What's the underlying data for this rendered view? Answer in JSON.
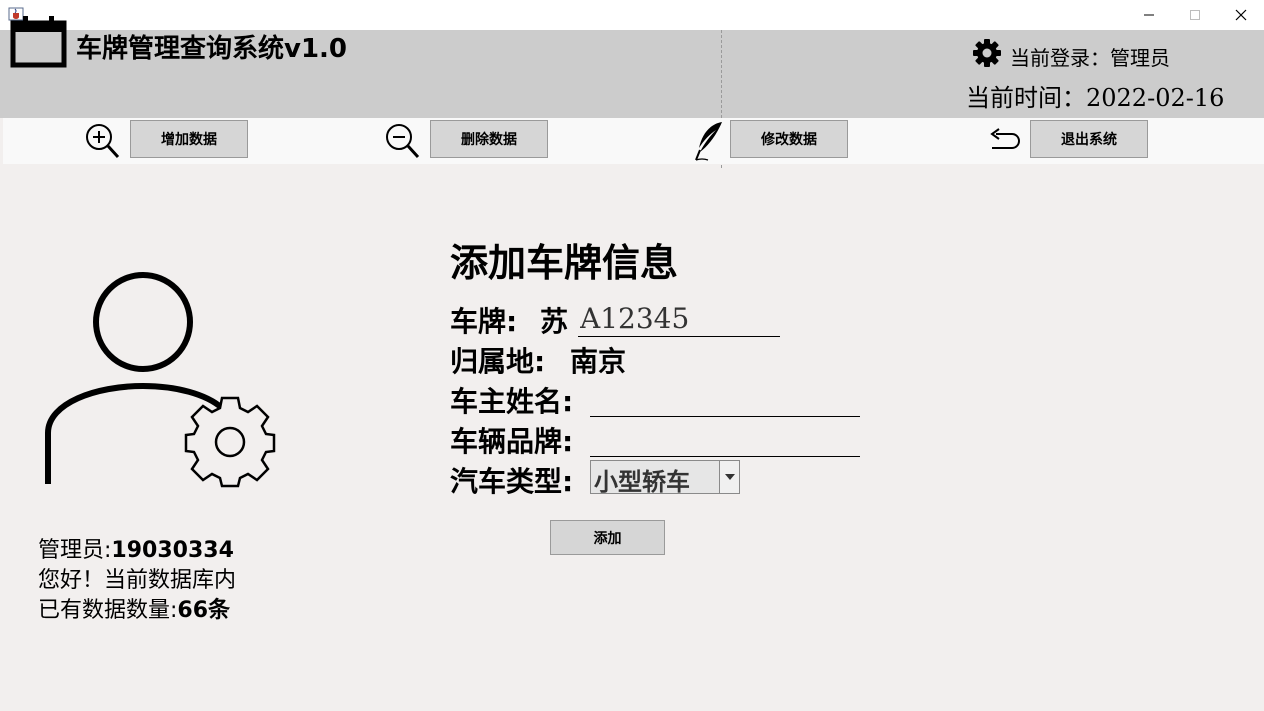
{
  "window": {
    "app_icon": "java-cup-icon",
    "controls": [
      "minimize-icon",
      "maximize-icon",
      "close-icon"
    ]
  },
  "header": {
    "title": "车牌管理查询系统v1.0",
    "login_label": "当前登录：",
    "login_user": "管理员",
    "time_label": "当前时间：",
    "time_value": "2022-02-16"
  },
  "toolbar": {
    "items": [
      {
        "icon": "zoom-in-icon",
        "label": "增加数据"
      },
      {
        "icon": "zoom-out-icon",
        "label": "删除数据"
      },
      {
        "icon": "quill-pen-icon",
        "label": "修改数据"
      },
      {
        "icon": "return-arrow-icon",
        "label": "退出系统"
      }
    ]
  },
  "sidebar": {
    "user_label": "管理员:",
    "user_id": "19030334",
    "greeting": "您好！当前数据库内",
    "count_label": "已有数据数量:",
    "count_value": "66条"
  },
  "form": {
    "title": "添加车牌信息",
    "plate_label": "车牌:",
    "plate_prefix": "苏",
    "plate_value": "A12345",
    "region_label": "归属地:",
    "region_value": "南京",
    "owner_label": "车主姓名:",
    "owner_value": "",
    "brand_label": "车辆品牌:",
    "brand_value": "",
    "type_label": "汽车类型:",
    "type_value": "小型轿车",
    "submit_label": "添加"
  }
}
